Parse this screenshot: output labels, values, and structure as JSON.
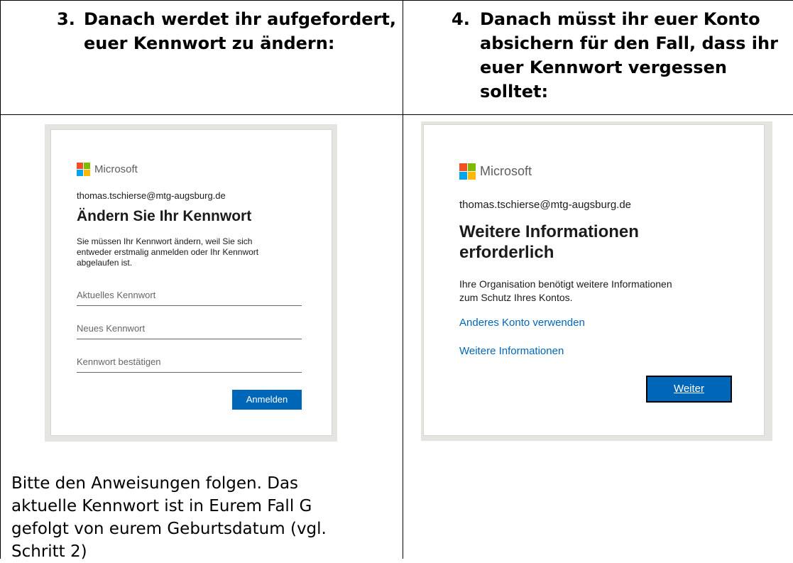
{
  "steps": [
    {
      "number": "3.",
      "lines": [
        "Danach werdet ihr aufgefordert,",
        "euer Kennwort zu ändern:"
      ]
    },
    {
      "number": "4.",
      "lines": [
        "Danach müsst ihr euer Konto",
        "absichern für den Fall, dass ihr",
        "euer Kennwort vergessen",
        "solltet:"
      ]
    }
  ],
  "screenshot_change_password": {
    "brand": "Microsoft",
    "email": "thomas.tschierse@mtg-augsburg.de",
    "title": "Ändern Sie Ihr Kennwort",
    "description_lines": [
      "Sie müssen Ihr Kennwort ändern, weil Sie sich",
      "entweder erstmalig anmelden oder Ihr Kennwort",
      "abgelaufen ist."
    ],
    "fields": [
      {
        "placeholder": "Aktuelles Kennwort"
      },
      {
        "placeholder": "Neues Kennwort"
      },
      {
        "placeholder": "Kennwort bestätigen"
      }
    ],
    "submit_label": "Anmelden"
  },
  "screenshot_more_info": {
    "brand": "Microsoft",
    "email": "thomas.tschierse@mtg-augsburg.de",
    "title_lines": [
      "Weitere Informationen",
      "erforderlich"
    ],
    "description_lines": [
      "Ihre Organisation benötigt weitere Informationen",
      "zum Schutz Ihres Kontos."
    ],
    "links": [
      "Anderes Konto verwenden",
      "Weitere Informationen"
    ],
    "button_label": "Weiter"
  },
  "note_lines": [
    "Bitte den Anweisungen folgen. Das",
    "aktuelle Kennwort ist in Eurem Fall G",
    "gefolgt von eurem Geburtsdatum (vgl.",
    "Schritt 2)"
  ],
  "colors": {
    "ms_red": "#f25022",
    "ms_green": "#7fba00",
    "ms_blue": "#00a4ef",
    "ms_yellow": "#ffb900",
    "accent_blue": "#0067b8"
  },
  "icons": [
    "microsoft-logo-icon"
  ]
}
